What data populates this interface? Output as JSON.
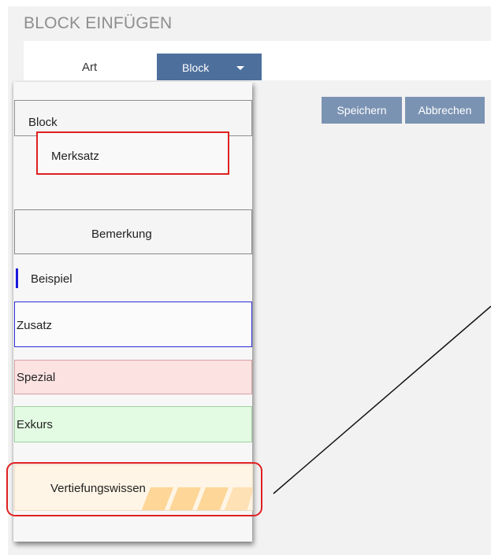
{
  "page": {
    "title": "BLOCK EINFÜGEN"
  },
  "form": {
    "art_label": "Art",
    "type_select": {
      "value": "Block"
    }
  },
  "actions": {
    "save_label": "Speichern",
    "cancel_label": "Abbrechen"
  },
  "dropdown": {
    "options": [
      {
        "label": "Block"
      },
      {
        "label": "Merksatz"
      },
      {
        "label": "Bemerkung"
      },
      {
        "label": "Beispiel"
      },
      {
        "label": "Zusatz"
      },
      {
        "label": "Spezial"
      },
      {
        "label": "Exkurs"
      },
      {
        "label": "Vertiefungswissen"
      }
    ]
  },
  "colors": {
    "select_bg": "#4d6f9c",
    "button_bg": "#7b93b3",
    "highlight": "#e02020",
    "beispiel_bar": "#1a1adc",
    "zusatz_border": "#2a2ad8",
    "spezial_bg": "#fde2e2",
    "exkurs_bg": "#e3fbe3",
    "vertiefung_bg": "#fff5e6"
  }
}
